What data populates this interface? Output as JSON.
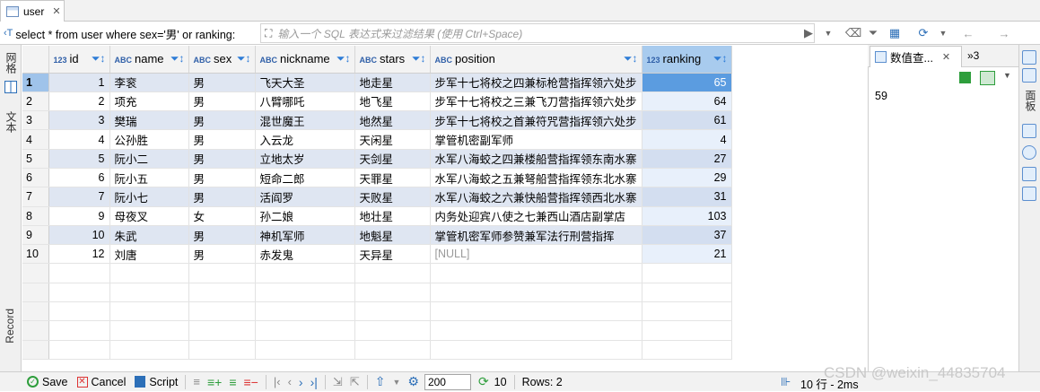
{
  "tab": {
    "title": "user",
    "close": "✕"
  },
  "filter": {
    "sql": "select * from user where sex='男' or ranking:",
    "placeholder": "输入一个 SQL 表达式来过滤结果 (使用 Ctrl+Space)"
  },
  "left_strip": {
    "grid_label": "网格",
    "text_label": "文本",
    "record_label": "Record"
  },
  "columns": [
    {
      "type": "123",
      "name": "id"
    },
    {
      "type": "ABC",
      "name": "name"
    },
    {
      "type": "ABC",
      "name": "sex"
    },
    {
      "type": "ABC",
      "name": "nickname"
    },
    {
      "type": "ABC",
      "name": "stars"
    },
    {
      "type": "ABC",
      "name": "position"
    },
    {
      "type": "123",
      "name": "ranking"
    }
  ],
  "rows": [
    [
      "1",
      "1",
      "李衮",
      "男",
      "飞天大圣",
      "地走星",
      "步军十七将校之四兼标枪营指挥领六处步",
      "65"
    ],
    [
      "2",
      "2",
      "项充",
      "男",
      "八臂哪吒",
      "地飞星",
      "步军十七将校之三兼飞刀营指挥领六处步",
      "64"
    ],
    [
      "3",
      "3",
      "樊瑞",
      "男",
      "混世魔王",
      "地然星",
      "步军十七将校之首兼符咒营指挥领六处步",
      "61"
    ],
    [
      "4",
      "4",
      "公孙胜",
      "男",
      "入云龙",
      "天闲星",
      "掌管机密副军师",
      "4"
    ],
    [
      "5",
      "5",
      "阮小二",
      "男",
      "立地太岁",
      "天剑星",
      "水军八海蛟之四兼楼船营指挥领东南水寨",
      "27"
    ],
    [
      "6",
      "6",
      "阮小五",
      "男",
      "短命二郎",
      "天罪星",
      "水军八海蛟之五兼弩船营指挥领东北水寨",
      "29"
    ],
    [
      "7",
      "7",
      "阮小七",
      "男",
      "活阎罗",
      "天败星",
      "水军八海蛟之六兼快船营指挥领西北水寨",
      "31"
    ],
    [
      "8",
      "9",
      "母夜叉",
      "女",
      "孙二娘",
      "地壮星",
      "内务处迎宾八使之七兼西山酒店副掌店",
      "103"
    ],
    [
      "9",
      "10",
      "朱武",
      "男",
      "神机军师",
      "地魁星",
      "掌管机密军师参赞兼军法行刑营指挥",
      "37"
    ],
    [
      "10",
      "12",
      "刘唐",
      "男",
      "赤发鬼",
      "天异星",
      "[NULL]",
      "21"
    ]
  ],
  "value_panel": {
    "tab_title": "数值查...",
    "more": "»3",
    "value": "59"
  },
  "right_strip": {
    "label": "面板"
  },
  "bottom": {
    "save": "Save",
    "cancel": "Cancel",
    "script": "Script",
    "fetch_size": "200",
    "refresh_count": "10",
    "rows_info": "Rows: 2",
    "status": "10 行 - 2ms"
  },
  "watermark": "CSDN @weixin_44835704",
  "colors": {
    "header_selected": "#a8cbee",
    "cell_selected": "#5b9ce0",
    "alt_row": "#dfe6f2",
    "accent": "#2c7bd6"
  }
}
